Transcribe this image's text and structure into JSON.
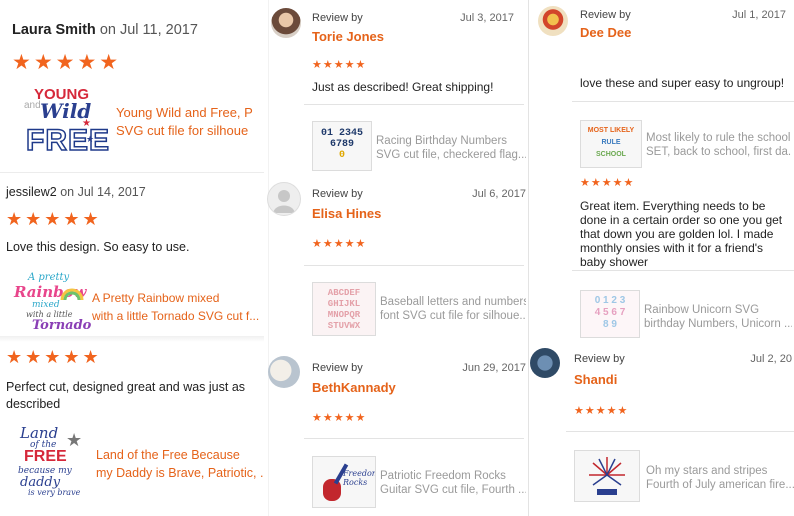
{
  "left": {
    "r1": {
      "user": "Laura Smith",
      "on": "on Jul 11, 2017",
      "stars": "★★★★★",
      "product": [
        "Young Wild and Free, P",
        "SVG cut file for silhoue"
      ],
      "art": {
        "a": "YOUNG",
        "b": "Wild",
        "c": "FREE",
        "pre": "and"
      }
    },
    "r2": {
      "user": "jessilew2",
      "on": "on Jul 14, 2017",
      "stars": "★★★★★",
      "text": "Love this design. So easy to use.",
      "product": [
        "A Pretty Rainbow mixed",
        "with a little Tornado SVG cut f..."
      ],
      "art": {
        "a": "A pretty",
        "b": "Rainbow",
        "c": "mixed",
        "d": "with a little",
        "e": "Tornado"
      }
    },
    "r3": {
      "stars": "★★★★★",
      "text": [
        "Perfect cut, designed great and was just as",
        "described"
      ],
      "product": [
        "Land of the Free Because",
        "my Daddy is Brave, Patriotic, ."
      ],
      "art": {
        "a": "Land",
        "b": "of the",
        "c": "FREE",
        "d": "because my",
        "e": "daddy",
        "f": "is very brave"
      }
    }
  },
  "mid": {
    "r1": {
      "review_by": "Review by",
      "date": "Jul 3, 2017",
      "name": "Torie Jones",
      "stars": "★★★★★",
      "text": "Just as described! Great shipping!",
      "product": [
        "Racing Birthday Numbers",
        "SVG cut file, checkered flag..."
      ],
      "thumb": [
        "01 2345",
        "6789",
        "0"
      ]
    },
    "r2": {
      "review_by": "Review by",
      "date": "Jul 6, 2017",
      "name": "Elisa Hines",
      "stars": "★★★★★",
      "product": [
        "Baseball letters and numbers",
        "font SVG cut file for silhoue..."
      ],
      "thumb": [
        "ABCDEF",
        "GHIJKL",
        "MNOPQR",
        "STUVWX"
      ]
    },
    "r3": {
      "review_by": "Review by",
      "date": "Jun 29, 2017",
      "name": "BethKannady",
      "stars": "★★★★★",
      "product": [
        "Patriotic Freedom Rocks",
        "Guitar SVG cut file, Fourth ..."
      ],
      "thumb": [
        "Freedom",
        "Rocks"
      ]
    }
  },
  "right": {
    "r1": {
      "review_by": "Review by",
      "date": "Jul 1, 2017",
      "name": "Dee Dee",
      "text": "love these and super easy to ungroup!"
    },
    "r2": {
      "product": [
        "Most likely to rule the school",
        "SET, back to school, first da..."
      ],
      "stars": "★★★★★",
      "text": [
        "Great item. Everything needs to be",
        "done in a certain order so one you get",
        "that down you are golden lol. I made",
        "monthly onsies with it for a friend's",
        "baby shower"
      ],
      "thumb": [
        "MOST LIKELY",
        "RULE",
        "SCHOOL"
      ]
    },
    "r3": {
      "product": [
        "Rainbow Unicorn SVG",
        "birthday Numbers, Unicorn ..."
      ],
      "thumb": [
        "0 1 2 3",
        "4 5 6 7",
        "8 9"
      ]
    },
    "r4": {
      "review_by": "Review by",
      "date": "Jul 2, 20",
      "name": "Shandi",
      "stars": "★★★★★",
      "product": [
        "Oh my stars and stripes",
        "Fourth of July american fire..."
      ]
    }
  },
  "colors": {
    "accent": "#e5631a",
    "star": "#f1641e",
    "divider": "#e3e3e3"
  }
}
